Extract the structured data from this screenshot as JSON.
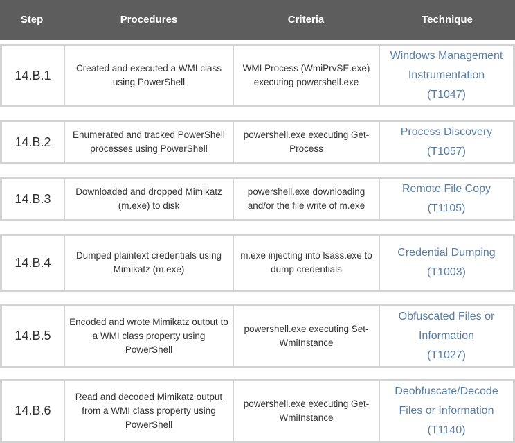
{
  "headers": {
    "step": "Step",
    "procedures": "Procedures",
    "criteria": "Criteria",
    "technique": "Technique"
  },
  "rows": [
    {
      "step": "14.B.1",
      "procedure": "Created and executed a WMI class using PowerShell",
      "criteria": "WMI Process (WmiPrvSE.exe) executing powershell.exe",
      "technique": "Windows Management Instrumentation",
      "technique_id": "(T1047)"
    },
    {
      "step": "14.B.2",
      "procedure": "Enumerated and tracked PowerShell processes using PowerShell",
      "criteria": "powershell.exe executing Get-Process",
      "technique": "Process Discovery",
      "technique_id": "(T1057)"
    },
    {
      "step": "14.B.3",
      "procedure": "Downloaded and dropped Mimikatz (m.exe) to disk",
      "criteria": "powershell.exe downloading and/or the file write of m.exe",
      "technique": "Remote File Copy",
      "technique_id": "(T1105)"
    },
    {
      "step": "14.B.4",
      "procedure": "Dumped plaintext credentials using Mimikatz (m.exe)",
      "criteria": "m.exe injecting into lsass.exe to dump credentials",
      "technique": "Credential Dumping",
      "technique_id": "(T1003)"
    },
    {
      "step": "14.B.5",
      "procedure": "Encoded and wrote Mimikatz output to a WMI class property using PowerShell",
      "criteria": "powershell.exe executing Set-WmiInstance",
      "technique": "Obfuscated Files or Information",
      "technique_id": "(T1027)"
    },
    {
      "step": "14.B.6",
      "procedure": "Read and decoded Mimikatz output from a WMI class property using PowerShell",
      "criteria": "powershell.exe executing Get-WmiInstance",
      "technique": "Deobfuscate/Decode Files or Information",
      "technique_id": "(T1140)"
    }
  ],
  "colors": {
    "header_bg": "#5d5d5d",
    "row_border": "#d3d3d3",
    "technique_link": "#5a7ea3"
  }
}
